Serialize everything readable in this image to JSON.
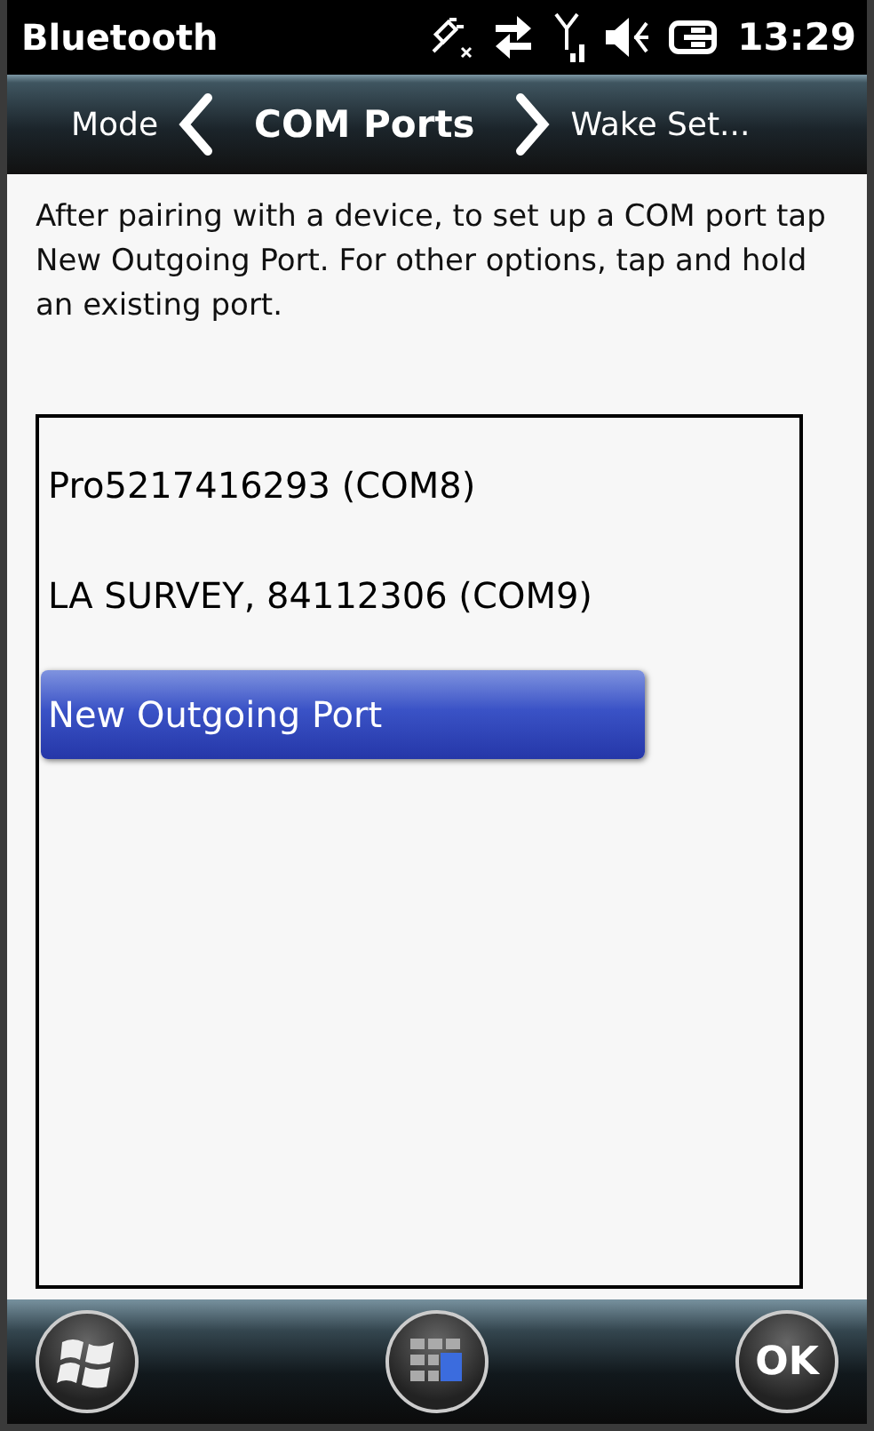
{
  "status_bar": {
    "title": "Bluetooth",
    "time": "13:29"
  },
  "nav": {
    "previous": "Mode",
    "current": "COM Ports",
    "next": "Wake Set..."
  },
  "instructions": "After pairing with a device, to set up a COM port tap New Outgoing Port. For other options, tap and hold an existing port.",
  "ports": [
    {
      "label": "Pro5217416293 (COM8)",
      "selected": false
    },
    {
      "label": "LA SURVEY, 84112306 (COM9)",
      "selected": false
    },
    {
      "label": "New Outgoing Port",
      "selected": true
    }
  ],
  "bottom_bar": {
    "ok": "OK"
  }
}
